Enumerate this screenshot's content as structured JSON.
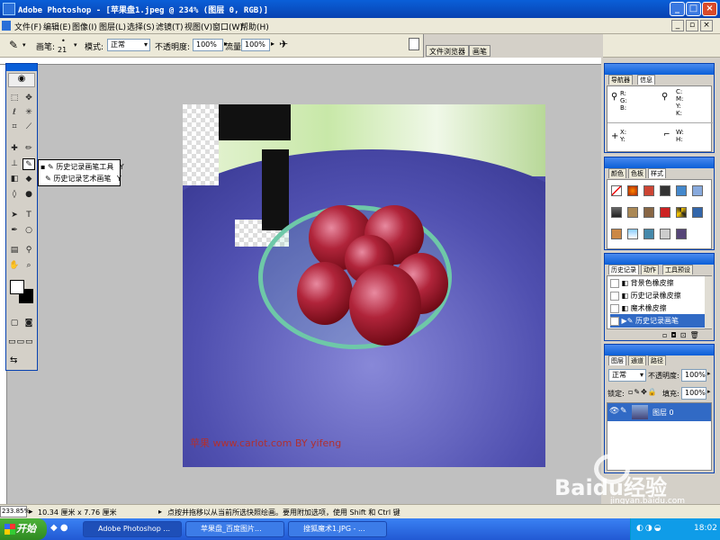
{
  "window": {
    "title": "Adobe Photoshop - [苹果盘1.jpeg @ 234% (图层 0, RGB)]",
    "controls": {
      "minimize": "_",
      "maximize": "□",
      "close": "×"
    }
  },
  "menu": [
    "文件(F)",
    "编辑(E)",
    "图像(I)",
    "图层(L)",
    "选择(S)",
    "滤镜(T)",
    "视图(V)",
    "窗口(W)",
    "帮助(H)"
  ],
  "options": {
    "brush_label": "画笔:",
    "brush_size": "21",
    "mode_label": "模式:",
    "mode_value": "正常",
    "opacity_label": "不透明度:",
    "opacity_value": "100%",
    "flow_label": "流量:",
    "flow_value": "100%",
    "palette_tabs": [
      "文件浏览器",
      "画笔"
    ]
  },
  "flyout": {
    "items": [
      {
        "label": "历史记录画笔工具",
        "key": "Y"
      },
      {
        "label": "历史记录艺术画笔",
        "key": "Y"
      }
    ]
  },
  "canvas": {
    "watermark": "苹果 www.carlot.com BY yifeng"
  },
  "navigator_panel": {
    "tabs": [
      "导航器",
      "信息"
    ],
    "rgb": [
      "R:",
      "G:",
      "B:"
    ],
    "cmyk": [
      "C:",
      "M:",
      "Y:",
      "K:"
    ],
    "xy": [
      "X:",
      "Y:"
    ],
    "wh": [
      "W:",
      "H:"
    ]
  },
  "swatches_panel": {
    "tabs": [
      "颜色",
      "色板",
      "样式"
    ]
  },
  "history_panel": {
    "tabs": [
      "历史记录",
      "动作",
      "工具预设"
    ],
    "items": [
      "背景色橡皮擦",
      "历史记录橡皮擦",
      "魔术橡皮擦",
      "历史记录画笔"
    ],
    "selected_index": 3
  },
  "layers_panel": {
    "tabs": [
      "图层",
      "通道",
      "路径"
    ],
    "blend_mode": "正常",
    "opacity_label": "不透明度:",
    "opacity_value": "100%",
    "lock_label": "锁定:",
    "fill_label": "填充:",
    "fill_value": "100%",
    "layer_name": "图层 0"
  },
  "status": {
    "zoom": "233.85%",
    "doc_size": "10.34 厘米 x 7.76 厘米",
    "hint": "点按并拖移以从当前所选快照绘画。要用附加选项，使用 Shift 和 Ctrl 键"
  },
  "taskbar": {
    "start": "开始",
    "tasks": [
      "Adobe Photoshop ...",
      "苹果盘_百度图片...",
      "搜狐魔术1.JPG - ..."
    ],
    "clock": "18:02"
  },
  "branding": {
    "logo": "Baidu经验",
    "url": "jingyan.baidu.com"
  },
  "colors": {
    "title_blue": "#0a5fd8",
    "panel_bg": "#d4d0c8",
    "history_selected": "#316ac5"
  }
}
